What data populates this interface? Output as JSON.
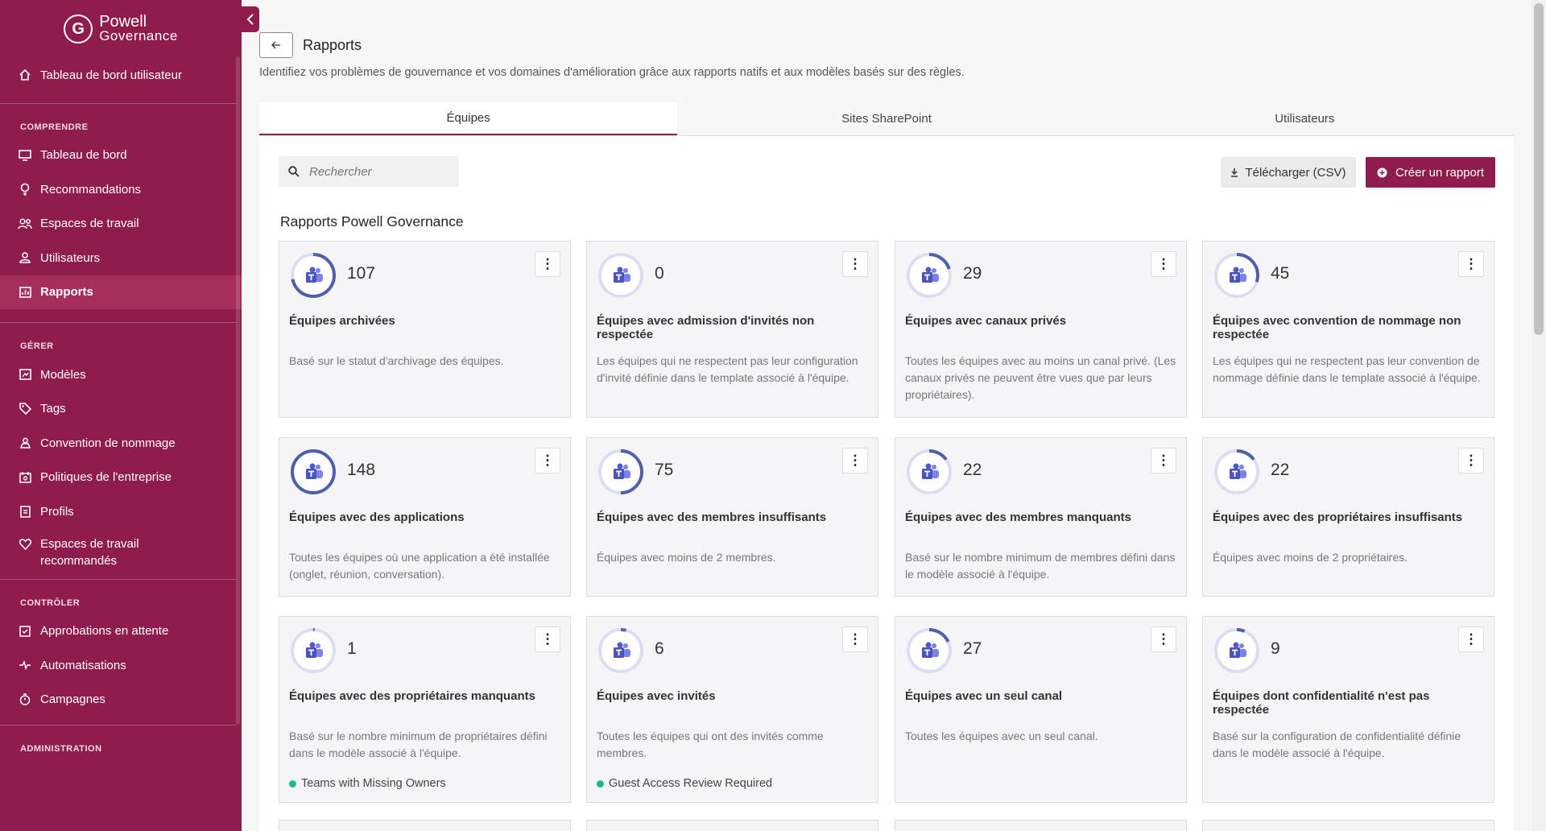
{
  "sidebar": {
    "logo": {
      "mark": "G",
      "line1": "Powell",
      "line2": "Governance"
    },
    "top_item": {
      "label": "Tableau de bord utilisateur",
      "icon": "home-icon"
    },
    "sections": {
      "comprendre": {
        "label": "COMPRENDRE",
        "items": [
          {
            "label": "Tableau de bord",
            "icon": "monitor-icon"
          },
          {
            "label": "Recommandations",
            "icon": "lightbulb-icon"
          },
          {
            "label": "Espaces de travail",
            "icon": "users-icon"
          },
          {
            "label": "Utilisateurs",
            "icon": "user-icon"
          },
          {
            "label": "Rapports",
            "icon": "report-icon",
            "active": true
          }
        ]
      },
      "gerer": {
        "label": "GÉRER",
        "items": [
          {
            "label": "Modèles",
            "icon": "template-icon"
          },
          {
            "label": "Tags",
            "icon": "tag-icon"
          },
          {
            "label": "Convention de nommage",
            "icon": "naming-icon"
          },
          {
            "label": "Politiques de l'entreprise",
            "icon": "policy-icon"
          },
          {
            "label": "Profils",
            "icon": "profile-icon"
          },
          {
            "label": "Espaces de travail",
            "label2": "recommandés",
            "icon": "heart-icon"
          }
        ]
      },
      "controler": {
        "label": "CONTRÔLER",
        "items": [
          {
            "label": "Approbations en attente",
            "icon": "approval-icon"
          },
          {
            "label": "Automatisations",
            "icon": "automation-icon"
          },
          {
            "label": "Campagnes",
            "icon": "stopwatch-icon"
          }
        ]
      },
      "administration": {
        "label": "ADMINISTRATION"
      }
    }
  },
  "header": {
    "title": "Rapports",
    "subtitle": "Identifiez vos problèmes de gouvernance et vos domaines d'amélioration grâce aux rapports natifs et aux modèles basés sur des règles."
  },
  "tabs": [
    {
      "label": "Équipes",
      "active": true
    },
    {
      "label": "Sites SharePoint"
    },
    {
      "label": "Utilisateurs"
    }
  ],
  "toolbar": {
    "search_placeholder": "Rechercher",
    "csv_label": "Télécharger (CSV)",
    "create_label": "Créer un rapport"
  },
  "section_title": "Rapports Powell Governance",
  "colors": {
    "brand": "#8e1c4c",
    "ring": "#4f5fa9",
    "ring_track": "#dcdef0",
    "tag_dot": "#1db98d"
  },
  "cards": [
    {
      "count": "107",
      "name": "Équipes archivées",
      "desc": "Basé sur le statut d'archivage des équipes.",
      "fraction": 0.72
    },
    {
      "count": "0",
      "name": "Équipes avec admission d'invités non respectée",
      "desc": "Les équipes qui ne respectent pas leur configuration d'invité définie dans le template associé à l'équipe.",
      "fraction": 0
    },
    {
      "count": "29",
      "name": "Équipes avec canaux privés",
      "desc": "Toutes les équipes avec au moins un canal privé. (Les canaux privés ne peuvent être vues que par leurs propriétaires).",
      "fraction": 0.2
    },
    {
      "count": "45",
      "name": "Équipes avec convention de nommage non respectée",
      "desc": "Les équipes qui ne respectent pas leur convention de nommage définie dans le template associé à l'équipe.",
      "fraction": 0.3
    },
    {
      "count": "148",
      "name": "Équipes avec des applications",
      "desc": "Toutes les équipes où une application a été installée (onglet, réunion, conversation).",
      "fraction": 1
    },
    {
      "count": "75",
      "name": "Équipes avec des membres insuffisants",
      "desc": "Équipes avec moins de 2 membres.",
      "fraction": 0.5
    },
    {
      "count": "22",
      "name": "Équipes avec des membres manquants",
      "desc": "Basé sur le nombre minimum de membres défini dans le modèle associé à l'équipe.",
      "fraction": 0.15
    },
    {
      "count": "22",
      "name": "Équipes avec des propriétaires insuffisants",
      "desc": "Équipes avec moins de 2 propriétaires.",
      "fraction": 0.15
    },
    {
      "count": "1",
      "name": "Équipes avec des propriétaires manquants",
      "desc": "Basé sur le nombre minimum de propriétaires défini dans le modèle associé à l'équipe.",
      "tag": "Teams with Missing Owners",
      "fraction": 0.01
    },
    {
      "count": "6",
      "name": "Équipes avec invités",
      "desc": "Toutes les équipes qui ont des invités comme membres.",
      "tag": "Guest Access Review Required",
      "fraction": 0.04
    },
    {
      "count": "27",
      "name": "Équipes avec un seul canal",
      "desc": "Toutes les équipes avec un seul canal.",
      "fraction": 0.18
    },
    {
      "count": "9",
      "name": "Équipes dont confidentialité n'est pas respectée",
      "desc": "Basé sur la configuration de confidentialité définie dans le modèle associé à l'équipe.",
      "fraction": 0.06
    }
  ]
}
